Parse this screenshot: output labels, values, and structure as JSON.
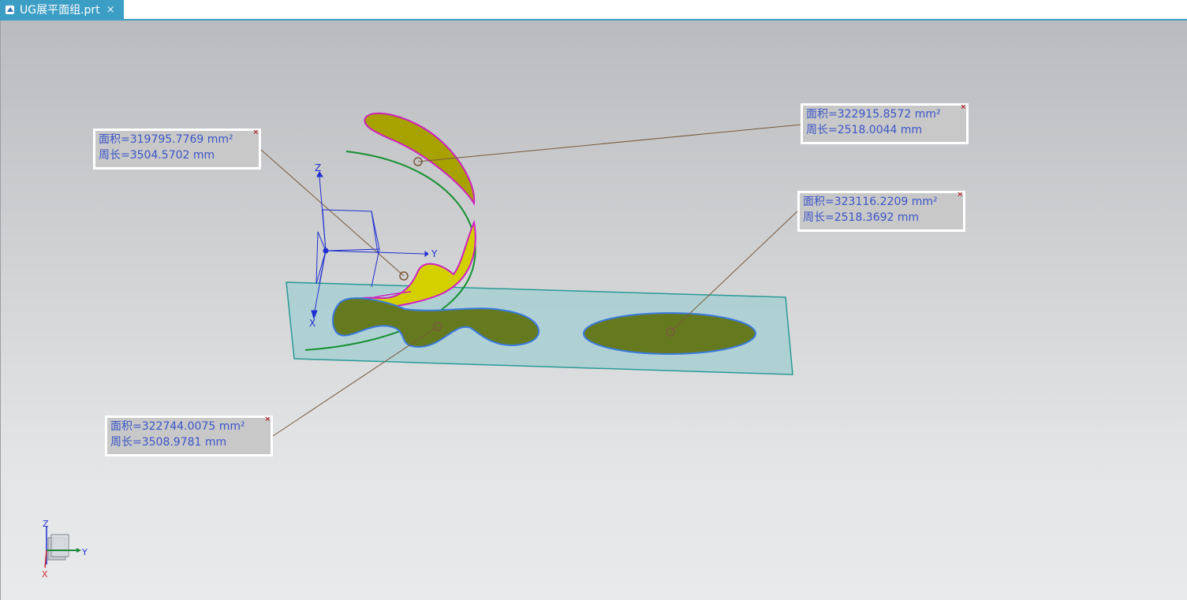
{
  "tab": {
    "title": "UG展平面组.prt",
    "close_label": "×"
  },
  "colors": {
    "tab_blue": "#3c9ec4",
    "note_text": "#3a55c7",
    "plane_fill": "#a8cfd2",
    "surface_olive": "#657a1f",
    "curved_surface_yellow": "#c8c400",
    "edge_magenta": "#d020c0",
    "edge_blue": "#3a7adf",
    "guide_green": "#169030"
  },
  "annotations": [
    {
      "area": "面积=319795.7769 mm²",
      "perimeter": "周长=3504.5702 mm",
      "close": "×"
    },
    {
      "area": "面积=322915.8572 mm²",
      "perimeter": "周长=2518.0044 mm",
      "close": "×"
    },
    {
      "area": "面积=323116.2209 mm²",
      "perimeter": "周长=2518.3692 mm",
      "close": "×"
    },
    {
      "area": "面积=322744.0075 mm²",
      "perimeter": "周长=3508.9781 mm",
      "close": "×"
    }
  ],
  "csys": {
    "z": "Z",
    "y": "Y",
    "x": "X"
  },
  "triad": {
    "z": "Z",
    "y": "Y",
    "x": "X"
  }
}
